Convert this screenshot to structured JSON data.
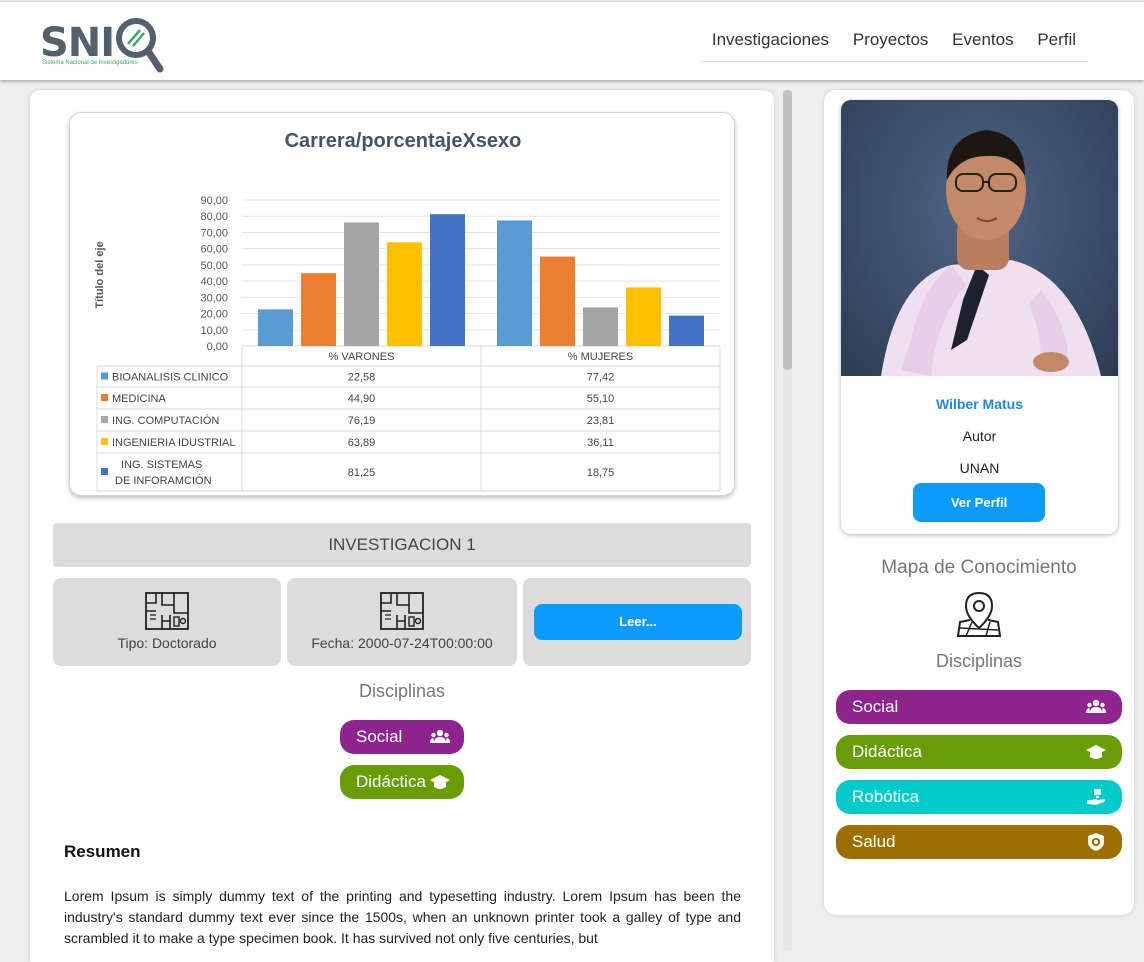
{
  "brand": {
    "logo_text": "SNI",
    "logo_subtitle": "Sistema Nacional de Investigadores"
  },
  "nav": {
    "items": [
      "Investigaciones",
      "Proyectos",
      "Eventos",
      "Perfil"
    ]
  },
  "chart_data": {
    "type": "bar",
    "title": "Carrera/porcentajeXsexo",
    "ylabel": "Título del eje",
    "xlabel": "",
    "ylim": [
      0,
      90
    ],
    "yticks": [
      "90,00",
      "80,00",
      "70,00",
      "60,00",
      "50,00",
      "40,00",
      "30,00",
      "20,00",
      "10,00",
      "0,00"
    ],
    "categories": [
      "% VARONES",
      "% MUJERES"
    ],
    "legend_position": "bottom-table",
    "series": [
      {
        "name": "BIOANALISIS CLINICO",
        "values": [
          22.58,
          77.42
        ],
        "labels": [
          "22,58",
          "77,42"
        ],
        "color": "#5b9bd5"
      },
      {
        "name": "MEDICINA",
        "values": [
          44.9,
          55.1
        ],
        "labels": [
          "44,90",
          "55,10"
        ],
        "color": "#ed7d31"
      },
      {
        "name": "ING. COMPUTACIÓN",
        "values": [
          76.19,
          23.81
        ],
        "labels": [
          "76,19",
          "23,81"
        ],
        "color": "#a5a5a5"
      },
      {
        "name": "INGENIERIA IDUSTRIAL",
        "values": [
          63.89,
          36.11
        ],
        "labels": [
          "63,89",
          "36,11"
        ],
        "color": "#ffc000"
      },
      {
        "name": "ING. SISTEMAS DE INFORAMCIÓN",
        "name_lines": [
          "ING. SISTEMAS",
          "DE INFORAMCIÓN"
        ],
        "values": [
          81.25,
          18.75
        ],
        "labels": [
          "81,25",
          "18,75"
        ],
        "color": "#4472c4"
      }
    ]
  },
  "investigation": {
    "title": "INVESTIGACION 1",
    "tipo": "Tipo: Doctorado",
    "fecha": "Fecha: 2000-07-24T00:00:00",
    "read_button": "Leer...",
    "disciplines_heading": "Disciplinas",
    "disciplines": [
      {
        "label": "Social",
        "color": "#8e248e",
        "icon": "users-icon"
      },
      {
        "label": "Didáctica",
        "color": "#689d06",
        "icon": "graduation-cap-icon"
      }
    ],
    "resumen_title": "Resumen",
    "resumen_text": "Lorem Ipsum is simply dummy text of the printing and typesetting industry. Lorem Ipsum has been the industry's standard dummy text ever since the 1500s, when an unknown printer took a galley of type and scrambled it to make a type specimen book. It has survived not only five centuries, but"
  },
  "profile": {
    "name": "Wilber Matus",
    "role": "Autor",
    "institution": "UNAN",
    "button": "Ver Perfil",
    "map_title": "Mapa de Conocimiento",
    "disciplines_heading": "Disciplinas",
    "disciplines": [
      {
        "label": "Social",
        "color": "#8e248e",
        "icon": "users-icon"
      },
      {
        "label": "Didáctica",
        "color": "#689d06",
        "icon": "graduation-cap-icon"
      },
      {
        "label": "Robótica",
        "color": "#00cbcb",
        "icon": "robot-hand-icon"
      },
      {
        "label": "Salud",
        "color": "#9c6f00",
        "icon": "shield-icon"
      }
    ]
  }
}
